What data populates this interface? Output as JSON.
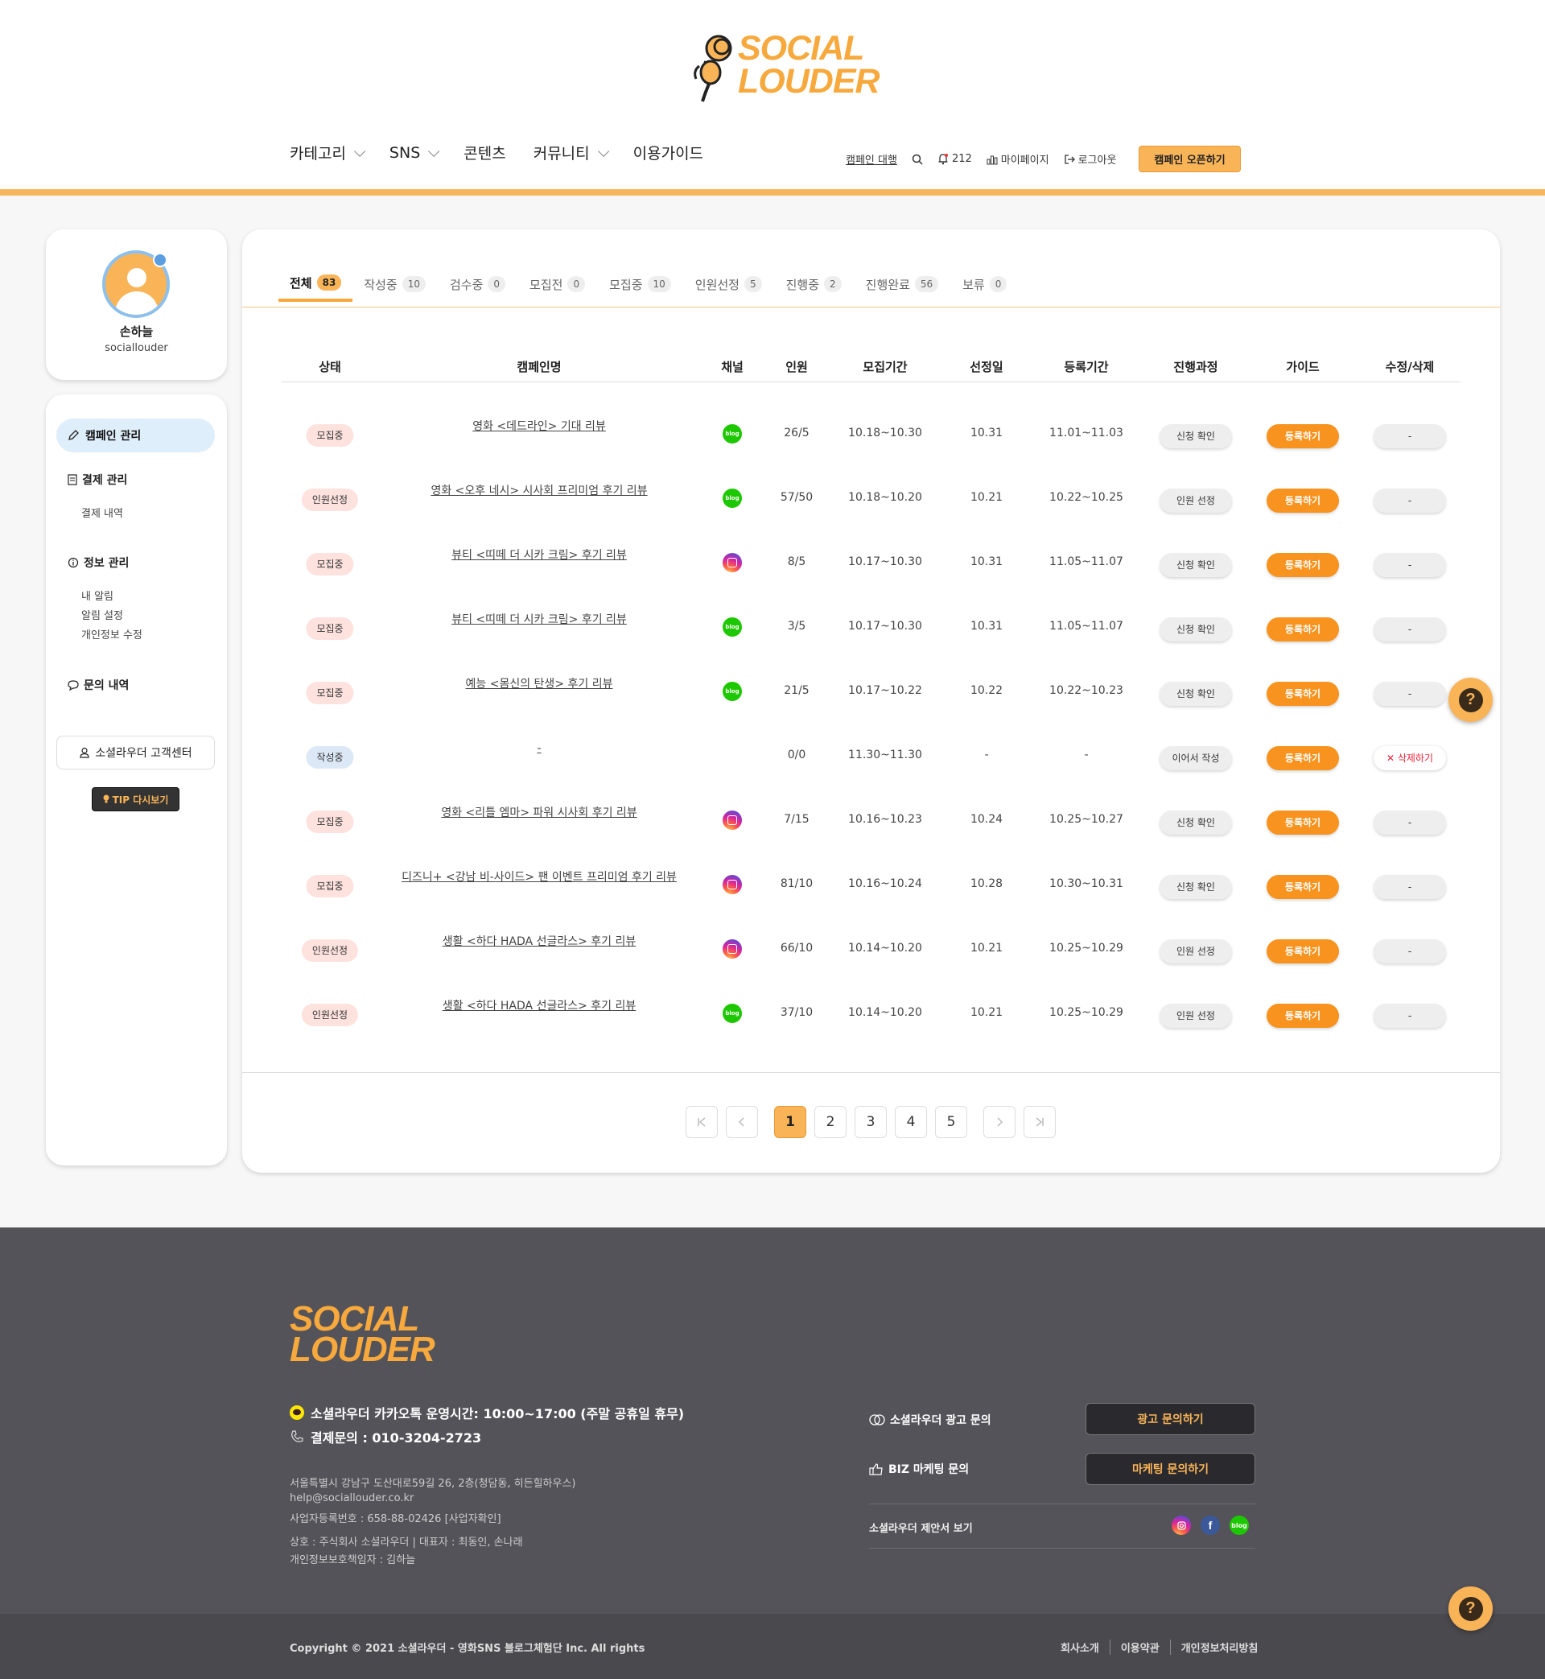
{
  "header": {
    "logo_line1": "SOCIAL",
    "logo_line2": "LOUDER",
    "nav": [
      {
        "label": "카테고리",
        "has_dropdown": true
      },
      {
        "label": "SNS",
        "has_dropdown": true
      },
      {
        "label": "콘텐츠",
        "has_dropdown": false
      },
      {
        "label": "커뮤니티",
        "has_dropdown": true
      },
      {
        "label": "이용가이드",
        "has_dropdown": false
      }
    ],
    "agency": "캠페인 대행",
    "notif_count": "212",
    "mypage": "마이페이지",
    "logout": "로그아웃",
    "open_campaign": "캠페인 오픈하기"
  },
  "profile": {
    "name": "손하늘",
    "id": "sociallouder"
  },
  "sidebar": {
    "campaign_manage": "캠페인 관리",
    "payment_manage": "결제 관리",
    "payment_history": "결제 내역",
    "info_manage": "정보 관리",
    "my_alerts": "내 알림",
    "alert_settings": "알림 설정",
    "edit_profile": "개인정보 수정",
    "inquiries": "문의 내역",
    "customer_center": "소셜라우더 고객센터",
    "tip": "TIP 다시보기"
  },
  "tabs": [
    {
      "label": "전체",
      "count": "83",
      "active": true
    },
    {
      "label": "작성중",
      "count": "10"
    },
    {
      "label": "검수중",
      "count": "0"
    },
    {
      "label": "모집전",
      "count": "0"
    },
    {
      "label": "모집중",
      "count": "10"
    },
    {
      "label": "인원선정",
      "count": "5"
    },
    {
      "label": "진행중",
      "count": "2"
    },
    {
      "label": "진행완료",
      "count": "56"
    },
    {
      "label": "보류",
      "count": "0"
    }
  ],
  "table": {
    "headers": [
      "상태",
      "캠페인명",
      "채널",
      "인원",
      "모집기간",
      "선정일",
      "등록기간",
      "진행과정",
      "가이드",
      "수정/삭제"
    ],
    "rows": [
      {
        "status": "모집중",
        "name": "영화 <데드라인> 기대 리뷰",
        "channel": "blog",
        "people": "26/5",
        "recruit": "10.18~10.30",
        "select": "10.31",
        "register": "11.01~11.03",
        "process": "신청 확인",
        "guide": "등록하기",
        "edit": "-"
      },
      {
        "status": "인원선정",
        "name": "영화 <오후 네시> 시사회 프리미엄 후기 리뷰",
        "channel": "blog",
        "people": "57/50",
        "recruit": "10.18~10.20",
        "select": "10.21",
        "register": "10.22~10.25",
        "process": "인원 선정",
        "guide": "등록하기",
        "edit": "-"
      },
      {
        "status": "모집중",
        "name": "뷰티 <띠떼 더 시카 크림> 후기 리뷰",
        "channel": "insta",
        "people": "8/5",
        "recruit": "10.17~10.30",
        "select": "10.31",
        "register": "11.05~11.07",
        "process": "신청 확인",
        "guide": "등록하기",
        "edit": "-"
      },
      {
        "status": "모집중",
        "name": "뷰티 <띠떼 더 시카 크림> 후기 리뷰",
        "channel": "blog",
        "people": "3/5",
        "recruit": "10.17~10.30",
        "select": "10.31",
        "register": "11.05~11.07",
        "process": "신청 확인",
        "guide": "등록하기",
        "edit": "-"
      },
      {
        "status": "모집중",
        "name": "예능 <몸신의 탄생> 후기 리뷰",
        "channel": "blog",
        "people": "21/5",
        "recruit": "10.17~10.22",
        "select": "10.22",
        "register": "10.22~10.23",
        "process": "신청 확인",
        "guide": "등록하기",
        "edit": "-"
      },
      {
        "status": "작성중",
        "name": "-",
        "channel": "",
        "people": "0/0",
        "recruit": "11.30~11.30",
        "select": "-",
        "register": "-",
        "process": "이어서 작성",
        "guide": "등록하기",
        "edit": "삭제하기"
      },
      {
        "status": "모집중",
        "name": "영화 <리틀 엠마> 파워 시사회 후기 리뷰",
        "channel": "insta",
        "people": "7/15",
        "recruit": "10.16~10.23",
        "select": "10.24",
        "register": "10.25~10.27",
        "process": "신청 확인",
        "guide": "등록하기",
        "edit": "-"
      },
      {
        "status": "모집중",
        "name": "디즈니+ <강남 비-사이드> 팬 이벤트 프리미엄 후기 리뷰",
        "channel": "insta",
        "people": "81/10",
        "recruit": "10.16~10.24",
        "select": "10.28",
        "register": "10.30~10.31",
        "process": "신청 확인",
        "guide": "등록하기",
        "edit": "-"
      },
      {
        "status": "인원선정",
        "name": "생활 <하다 HADA 선글라스> 후기 리뷰",
        "channel": "insta",
        "people": "66/10",
        "recruit": "10.14~10.20",
        "select": "10.21",
        "register": "10.25~10.29",
        "process": "인원 선정",
        "guide": "등록하기",
        "edit": "-"
      },
      {
        "status": "인원선정",
        "name": "생활 <하다 HADA 선글라스> 후기 리뷰",
        "channel": "blog",
        "people": "37/10",
        "recruit": "10.14~10.20",
        "select": "10.21",
        "register": "10.25~10.29",
        "process": "인원 선정",
        "guide": "등록하기",
        "edit": "-"
      }
    ]
  },
  "pagination": {
    "pages": [
      "1",
      "2",
      "3",
      "4",
      "5"
    ],
    "current": "1"
  },
  "footer": {
    "logo_line1": "SOCIAL",
    "logo_line2": "LOUDER",
    "kakao": "소셜라우더 카카오톡 운영시간: 10:00~17:00 (주말 공휴일 휴무)",
    "tel": "결제문의 : 010-3204-2723",
    "address": "서울특별시 강남구 도산대로59길 26, 2층(청담동, 히든힐하우스)",
    "email": "help@sociallouder.co.kr",
    "biz_no": "사업자등록번호 : 658-88-02426 [사업자확인]",
    "company": "상호 : 주식회사 소셜라우더 | 대표자 : 최동인, 손나래",
    "privacy_officer": "개인정보보호책임자 : 김하늘",
    "ad_inquiry_label": "소셜라우더 광고 문의",
    "ad_inquiry_btn": "광고 문의하기",
    "biz_inquiry_label": "BIZ 마케팅 문의",
    "biz_inquiry_btn": "마케팅 문의하기",
    "proposal": "소셜라우더 제안서 보기",
    "copyright": "Copyright © 2021 소셜라우더 - 영화SNS 블로그체험단 Inc. All rights",
    "links": [
      "회사소개",
      "이용약관",
      "개인정보처리방침"
    ]
  },
  "colors": {
    "accent": "#f7a93d",
    "guide_button": "#f7931e",
    "footer_bg": "#545359"
  }
}
